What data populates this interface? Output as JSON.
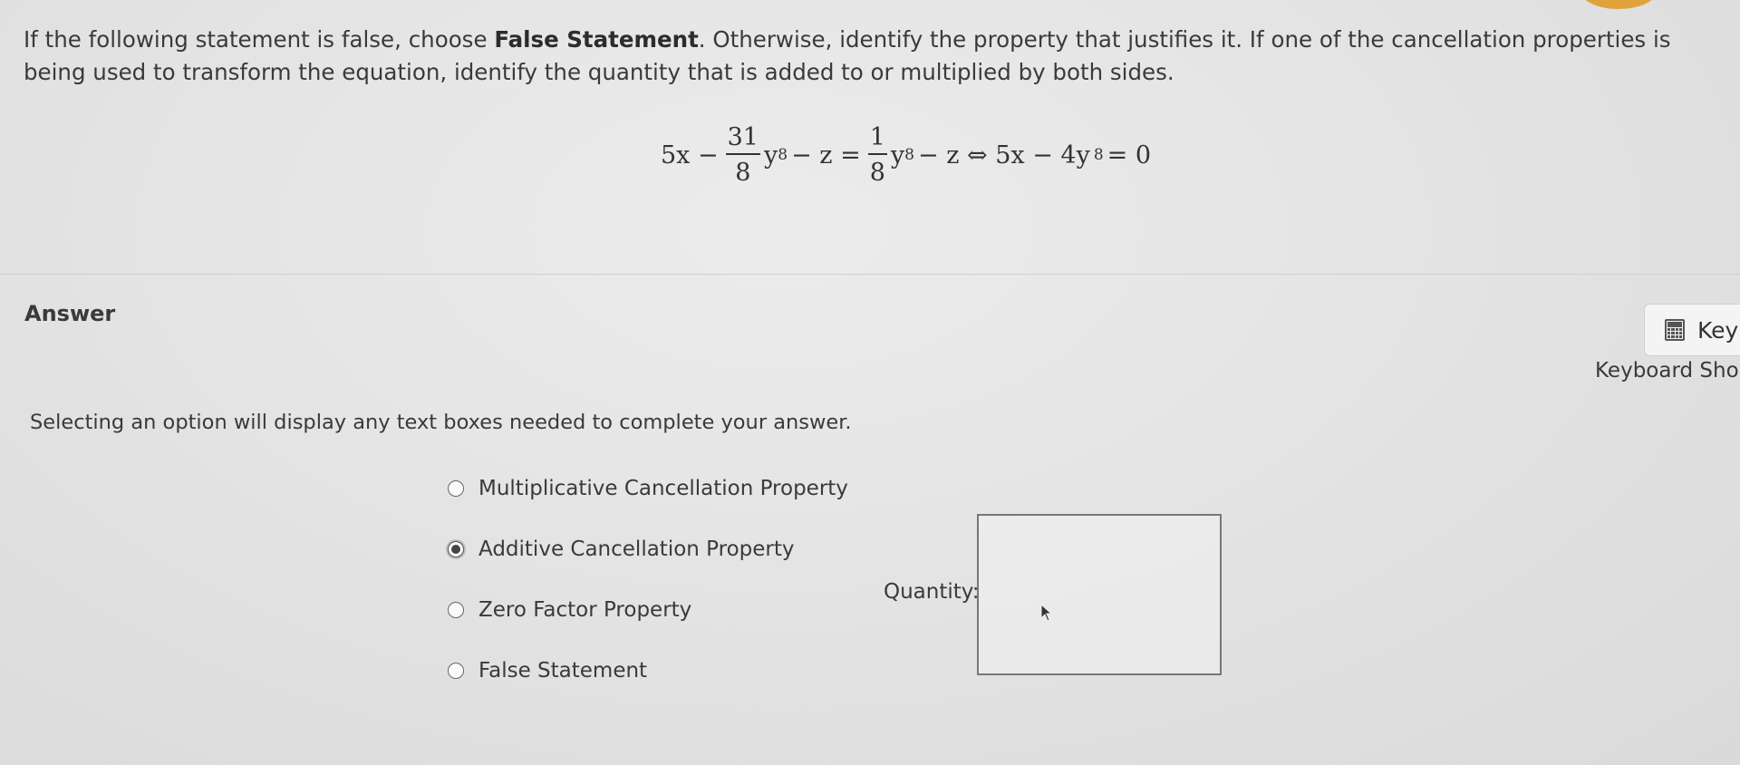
{
  "question": {
    "text_before": "If the following statement is false, choose ",
    "bold": "False Statement",
    "text_after": ". Otherwise, identify the property that justifies it. If one of the cancellation properties is being used to transform the equation, identify the quantity that is added to or multiplied by both sides."
  },
  "equation": {
    "lhs_start": "5x −",
    "frac1_num": "31",
    "frac1_den": "8",
    "lhs_y": "y",
    "lhs_exp": "8",
    "lhs_end": "− z =",
    "frac2_num": "1",
    "frac2_den": "8",
    "rhs_y": "y",
    "rhs_exp": "8",
    "rhs_end": "− z ⇔ 5x − 4y",
    "rhs2_exp": "8",
    "rhs2_end": "= 0"
  },
  "answer": {
    "heading": "Answer",
    "keypad_label": "Key",
    "shortcuts_label": "Keyboard Sho",
    "instruction": "Selecting an option will display any text boxes needed to complete your answer.",
    "options": [
      {
        "label": "Multiplicative Cancellation Property",
        "selected": false
      },
      {
        "label": "Additive Cancellation Property",
        "selected": true
      },
      {
        "label": "Zero Factor Property",
        "selected": false
      },
      {
        "label": "False Statement",
        "selected": false
      }
    ],
    "quantity_label": "Quantity:",
    "quantity_value": ""
  },
  "icons": {
    "keypad": "calculator-icon",
    "radio": "radio-icon",
    "cursor": "mouse-pointer-icon"
  }
}
